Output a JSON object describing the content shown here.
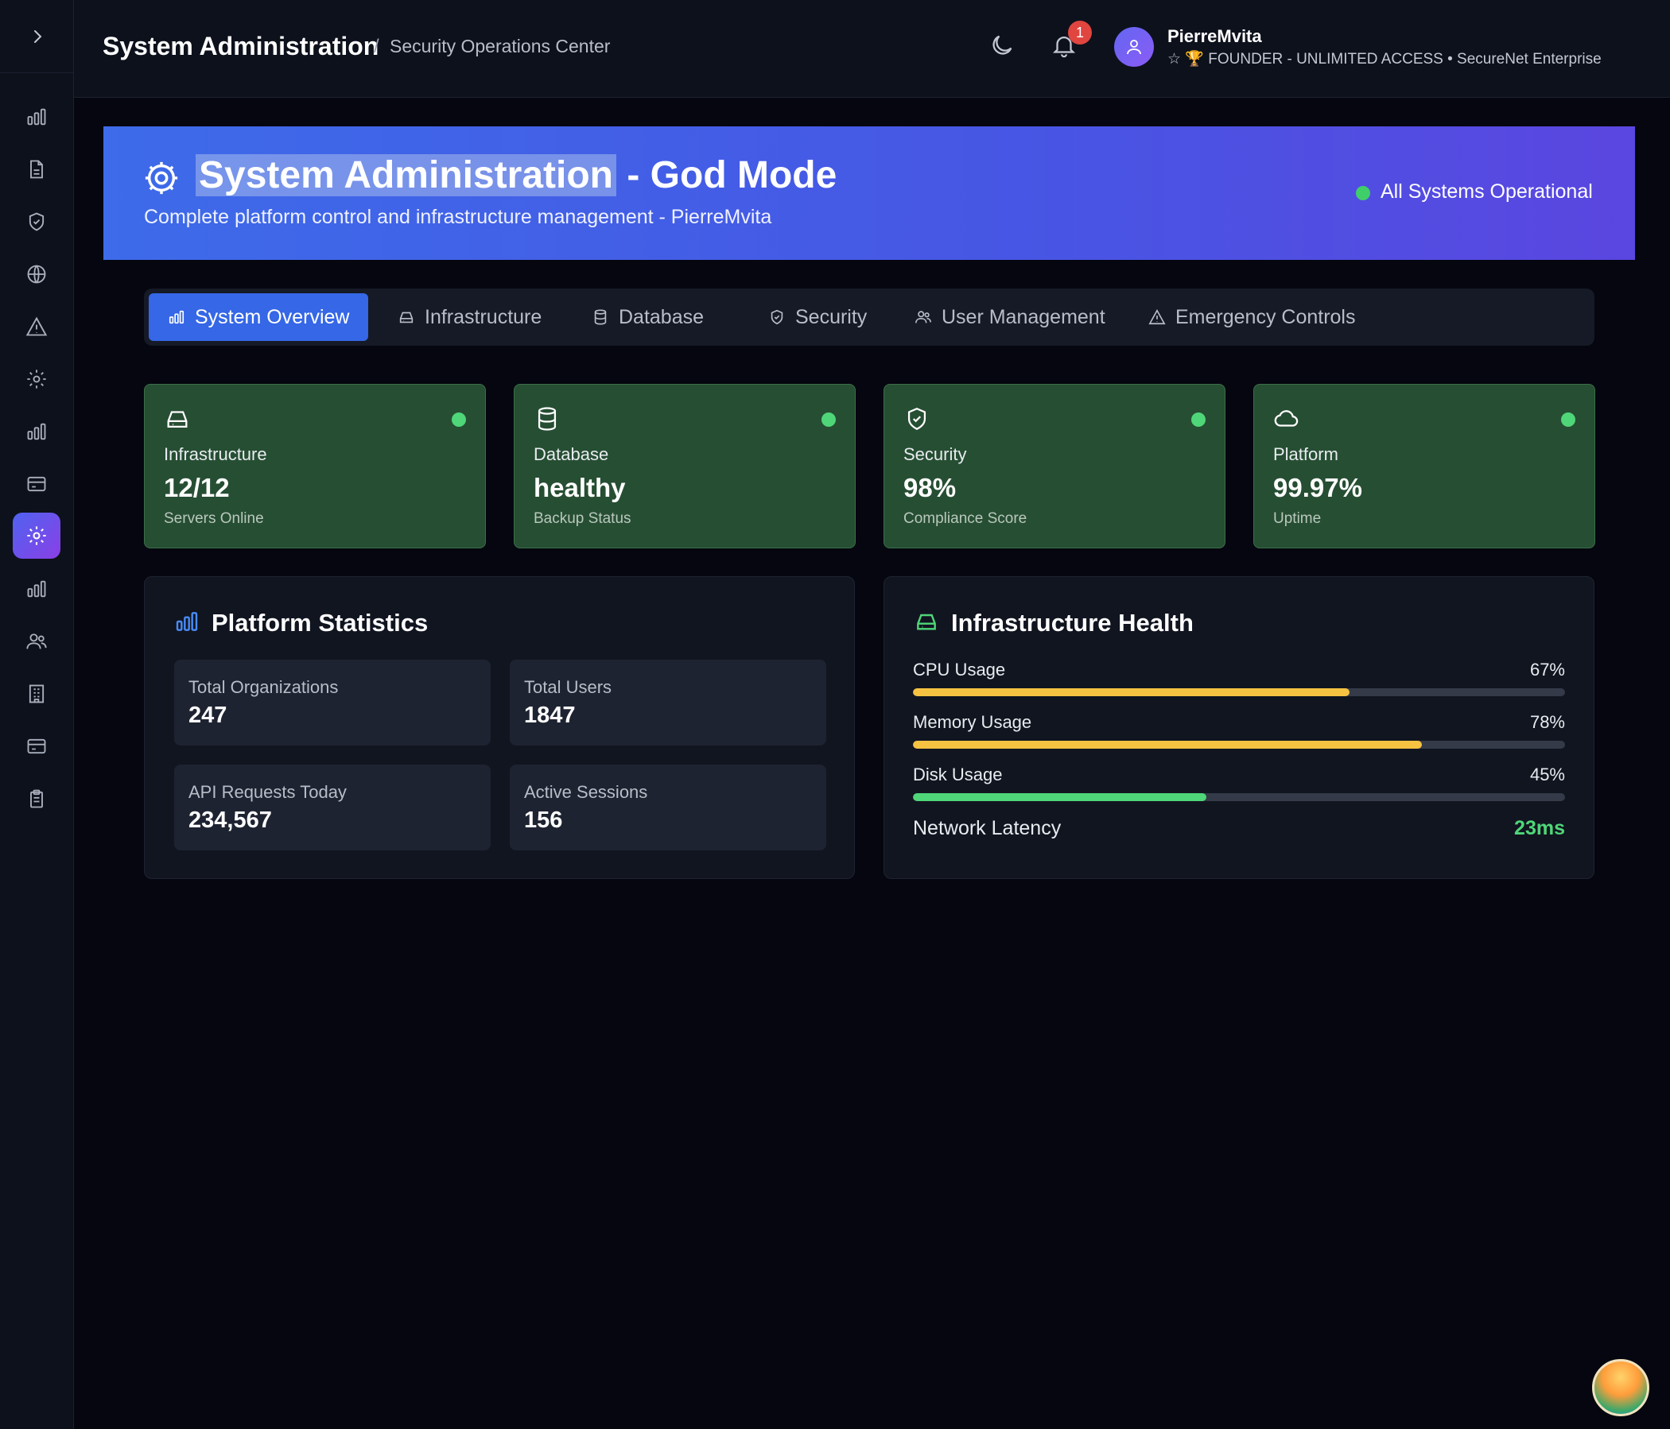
{
  "header": {
    "title": "System Administration",
    "separator": "/",
    "subtitle": "Security Operations Center",
    "notification_count": "1",
    "user_name": "PierreMvita",
    "user_role": "☆ 🏆 FOUNDER - UNLIMITED ACCESS • SecureNet Enterprise"
  },
  "sidebar": {
    "items": [
      {
        "icon": "bar-chart-icon"
      },
      {
        "icon": "document-icon"
      },
      {
        "icon": "shield-icon"
      },
      {
        "icon": "globe-icon"
      },
      {
        "icon": "alert-triangle-icon"
      },
      {
        "icon": "gear-icon"
      },
      {
        "icon": "bar-chart-icon"
      },
      {
        "icon": "credit-card-icon"
      },
      {
        "icon": "gear-icon",
        "active": true
      },
      {
        "icon": "bar-chart-icon"
      },
      {
        "icon": "users-icon"
      },
      {
        "icon": "building-icon"
      },
      {
        "icon": "credit-card-icon"
      },
      {
        "icon": "clipboard-icon"
      }
    ]
  },
  "banner": {
    "title_highlight": "System Administration",
    "title_rest": " - God Mode",
    "subtitle": "Complete platform control and infrastructure management - PierreMvita",
    "status": "All Systems Operational"
  },
  "tabs": [
    {
      "label": "System Overview",
      "icon": "bar-chart-icon",
      "active": true
    },
    {
      "label": "Infrastructure",
      "icon": "hard-drive-icon"
    },
    {
      "label": "Database",
      "icon": "database-icon"
    },
    {
      "label": "Security",
      "icon": "shield-icon"
    },
    {
      "label": "User Management",
      "icon": "users-icon"
    },
    {
      "label": "Emergency Controls",
      "icon": "alert-triangle-icon"
    }
  ],
  "status_cards": [
    {
      "label": "Infrastructure",
      "value": "12/12",
      "note": "Servers Online",
      "icon": "hard-drive-icon"
    },
    {
      "label": "Database",
      "value": "healthy",
      "note": "Backup Status",
      "icon": "database-icon"
    },
    {
      "label": "Security",
      "value": "98%",
      "note": "Compliance Score",
      "icon": "shield-check-icon"
    },
    {
      "label": "Platform",
      "value": "99.97%",
      "note": "Uptime",
      "icon": "cloud-icon"
    }
  ],
  "platform_statistics": {
    "title": "Platform Statistics",
    "stats": [
      {
        "label": "Total Organizations",
        "value": "247"
      },
      {
        "label": "Total Users",
        "value": "1847"
      },
      {
        "label": "API Requests Today",
        "value": "234,567"
      },
      {
        "label": "Active Sessions",
        "value": "156"
      }
    ]
  },
  "infrastructure_health": {
    "title": "Infrastructure Health",
    "metrics": [
      {
        "label": "CPU Usage",
        "percent_text": "67%",
        "fraction": 0.67,
        "color": "#f5c242"
      },
      {
        "label": "Memory Usage",
        "percent_text": "78%",
        "fraction": 0.78,
        "color": "#f5c242"
      },
      {
        "label": "Disk Usage",
        "percent_text": "45%",
        "fraction": 0.45,
        "color": "#4fd678"
      }
    ],
    "network_label": "Network Latency",
    "network_value": "23ms"
  },
  "colors": {
    "accent": "#3567e6",
    "success": "#4fd678",
    "warning": "#f5c242",
    "card_bg": "#264e33"
  }
}
